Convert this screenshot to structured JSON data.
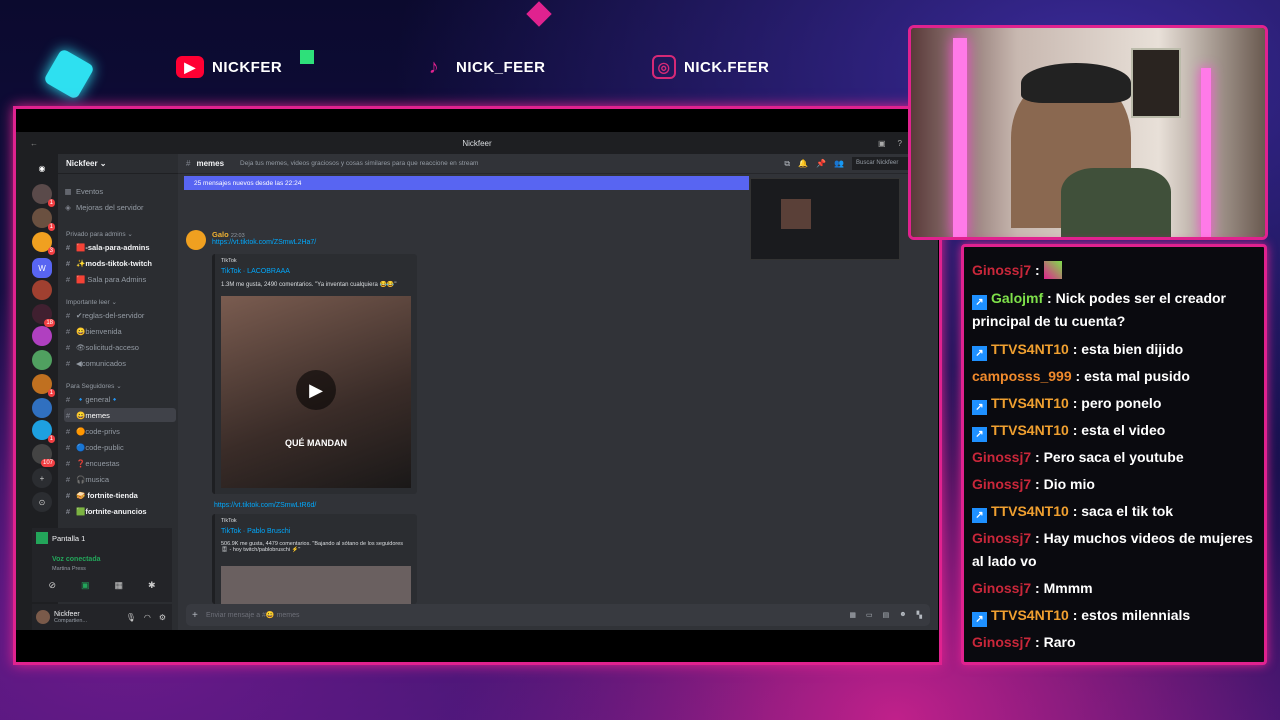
{
  "colors": {
    "accent": "#e0228f",
    "discord_blurple": "#5865f2",
    "link": "#00a8fc"
  },
  "socials": [
    {
      "icon": "youtube-icon",
      "handle": "NICKFER",
      "color": "#ff0033"
    },
    {
      "icon": "tiktok-icon",
      "handle": "NICK_FEER",
      "color": "#e0228f"
    },
    {
      "icon": "instagram-icon",
      "handle": "NICK.FEER",
      "color": "#d62976"
    }
  ],
  "discord": {
    "window_title": "Nickfeer",
    "server_name": "Nickfeer ⌄",
    "top_items": [
      "Eventos",
      "Mejoras del servidor"
    ],
    "categories": [
      "Privado para admins ⌄",
      "Importante leer ⌄",
      "Para Seguidores ⌄"
    ],
    "channels": [
      "🟥-sala-para-admins",
      "✨mods-tiktok-twitch",
      "🟥 Sala para Admins",
      "✔reglas-del-servidor",
      "😀bienvenida",
      "👁solicitud-acceso",
      "◀comunicados",
      "🔹general🔹",
      "😀memes",
      "🟠code-privs",
      "🔵code-public",
      "❓encuestas",
      "🎧musica",
      "🥪 fortnite-tienda",
      "🟩fortnite-anuncios"
    ],
    "server_badges": [
      "1",
      "1",
      "3",
      "18",
      "1",
      "1",
      "107"
    ],
    "voice": {
      "title": "Pantalla 1",
      "status": "Voz conectada",
      "sub": "Martina Press"
    },
    "user": {
      "name": "Nickfeer",
      "status": "Compartien..."
    },
    "channel": {
      "name": "memes",
      "topic": "Deja tus memes, videos graciosos y cosas similares para que reaccione en stream",
      "search": "Buscar Nickfeer"
    },
    "new_banner": "25 mensajes nuevos desde las 22:24",
    "message": {
      "author": "Galo",
      "time": "22:03",
      "link1": "https://vt.tiktok.com/ZSmwL2Ha7/",
      "embed1": {
        "provider": "TikTok",
        "title": "TikTok · LACOBRAAA",
        "desc": "1.3M me gusta, 2490 comentarios. \"Ya inventan cualquiera 😂😂\"",
        "caption": "QUÉ MANDAN"
      },
      "link2": "https://vt.tiktok.com/ZSmwLtR6d/",
      "embed2": {
        "provider": "TikTok",
        "title": "TikTok · Pablo Bruschi",
        "desc": "506.9K me gusta, 4479 comentarios. \"Bajando al sótano de los seguidores 🎚 - hoy twitch/pablobruschi ⚡\""
      }
    },
    "composer_placeholder": "Enviar mensaje a #😀 memes"
  },
  "chat": [
    {
      "user": "Ginossj7",
      "color": "#c9273a",
      "badge": false,
      "text": ""
    },
    {
      "user": "Galojmf",
      "color": "#7ee04a",
      "badge": true,
      "text": "Nick podes ser el creador principal de tu cuenta?"
    },
    {
      "user": "TTVS4NT10",
      "color": "#f0a030",
      "badge": true,
      "text": "esta bien dijido"
    },
    {
      "user": "camposss_999",
      "color": "#f08a2c",
      "badge": false,
      "text": "esta mal pusido"
    },
    {
      "user": "TTVS4NT10",
      "color": "#f0a030",
      "badge": true,
      "text": "pero ponelo"
    },
    {
      "user": "TTVS4NT10",
      "color": "#f0a030",
      "badge": true,
      "text": "esta el video"
    },
    {
      "user": "Ginossj7",
      "color": "#c9273a",
      "badge": false,
      "text": "Pero saca el youtube"
    },
    {
      "user": "Ginossj7",
      "color": "#c9273a",
      "badge": false,
      "text": "Dio mio"
    },
    {
      "user": "TTVS4NT10",
      "color": "#f0a030",
      "badge": true,
      "text": "saca el tik tok"
    },
    {
      "user": "Ginossj7",
      "color": "#c9273a",
      "badge": false,
      "text": "Hay muchos videos de mujeres al lado vo"
    },
    {
      "user": "Ginossj7",
      "color": "#c9273a",
      "badge": false,
      "text": "Mmmm"
    },
    {
      "user": "TTVS4NT10",
      "color": "#f0a030",
      "badge": true,
      "text": "estos milennials"
    },
    {
      "user": "Ginossj7",
      "color": "#c9273a",
      "badge": false,
      "text": "Raro"
    }
  ]
}
